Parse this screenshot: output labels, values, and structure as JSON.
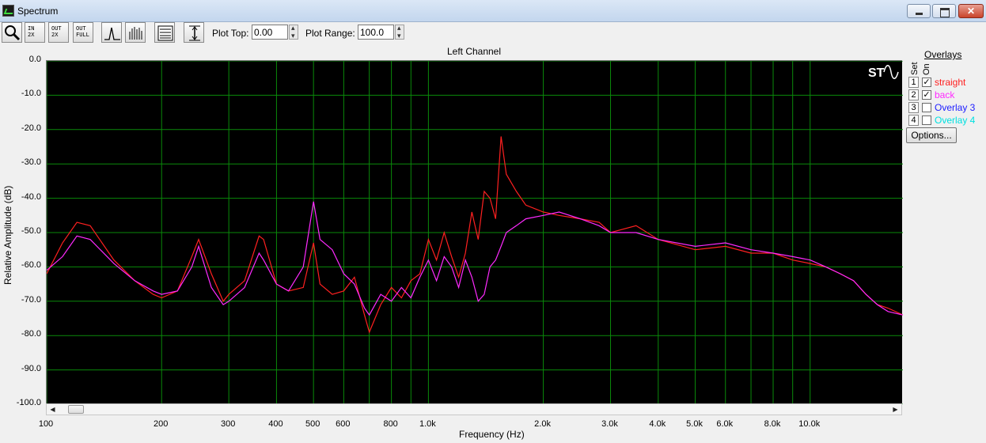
{
  "window": {
    "title": "Spectrum"
  },
  "toolbar": {
    "zoom_in_x": "IN 2X",
    "zoom_out_x": "OUT 2X",
    "zoom_out_full": "OUT FULL",
    "plot_top_label": "Plot Top:",
    "plot_top_value": "0.00",
    "plot_range_label": "Plot Range:",
    "plot_range_value": "100.0"
  },
  "plot": {
    "channel_title": "Left Channel"
  },
  "overlays": {
    "header": "Overlays",
    "col_set": "Set",
    "col_on": "On",
    "items": [
      {
        "num": "1",
        "checked": true,
        "name": "straight",
        "color": "#ff2020"
      },
      {
        "num": "2",
        "checked": true,
        "name": "back",
        "color": "#ff2aff"
      },
      {
        "num": "3",
        "checked": false,
        "name": "Overlay 3",
        "color": "#2020ff"
      },
      {
        "num": "4",
        "checked": false,
        "name": "Overlay 4",
        "color": "#00e0e0"
      }
    ],
    "options_label": "Options..."
  },
  "chart_data": {
    "type": "line",
    "title": "Left Channel",
    "xlabel": "Frequency (Hz)",
    "ylabel": "Relative Amplitude (dB)",
    "x_scale": "log",
    "xlim": [
      100,
      17500
    ],
    "ylim": [
      -100,
      0
    ],
    "x_ticks": [
      100,
      200,
      300,
      400,
      500,
      600,
      800,
      1000,
      2000,
      3000,
      4000,
      5000,
      6000,
      8000,
      10000
    ],
    "x_tick_labels": [
      "100",
      "200",
      "300",
      "400",
      "500",
      "600",
      "800",
      "1.0k",
      "2.0k",
      "3.0k",
      "4.0k",
      "5.0k",
      "6.0k",
      "8.0k",
      "10.0k"
    ],
    "y_ticks": [
      0,
      -10,
      -20,
      -30,
      -40,
      -50,
      -60,
      -70,
      -80,
      -90,
      -100
    ],
    "y_tick_labels": [
      "0.0",
      "-10.0",
      "-20.0",
      "-30.0",
      "-40.0",
      "-50.0",
      "-60.0",
      "-70.0",
      "-80.0",
      "-90.0",
      "-100.0"
    ],
    "grid": true,
    "series": [
      {
        "name": "straight",
        "color": "#ff2020",
        "x": [
          100,
          110,
          120,
          130,
          150,
          170,
          190,
          200,
          220,
          240,
          250,
          270,
          290,
          300,
          330,
          360,
          370,
          400,
          430,
          470,
          500,
          520,
          560,
          600,
          640,
          680,
          700,
          750,
          800,
          850,
          900,
          950,
          1000,
          1050,
          1100,
          1150,
          1200,
          1250,
          1300,
          1350,
          1400,
          1450,
          1500,
          1550,
          1600,
          1700,
          1800,
          2000,
          2200,
          2500,
          2800,
          3000,
          3500,
          4000,
          5000,
          6000,
          7000,
          8000,
          9000,
          10000,
          11000,
          12000,
          13000,
          14000,
          15000,
          16000,
          17500
        ],
        "y": [
          -62,
          -53,
          -47,
          -48,
          -58,
          -64,
          -68,
          -69,
          -67,
          -57,
          -52,
          -62,
          -70,
          -68,
          -64,
          -51,
          -52,
          -65,
          -67,
          -66,
          -53,
          -65,
          -68,
          -67,
          -63,
          -74,
          -79,
          -71,
          -66,
          -69,
          -64,
          -62,
          -52,
          -58,
          -50,
          -57,
          -63,
          -56,
          -44,
          -52,
          -38,
          -40,
          -46,
          -22,
          -33,
          -38,
          -42,
          -44,
          -45,
          -46,
          -47,
          -50,
          -48,
          -52,
          -55,
          -54,
          -56,
          -56,
          -58,
          -59,
          -60,
          -62,
          -64,
          -68,
          -71,
          -72,
          -74
        ]
      },
      {
        "name": "back",
        "color": "#ff2aff",
        "x": [
          100,
          110,
          120,
          130,
          150,
          170,
          190,
          200,
          220,
          240,
          250,
          270,
          290,
          300,
          330,
          360,
          370,
          400,
          430,
          470,
          500,
          520,
          560,
          600,
          640,
          680,
          700,
          750,
          800,
          850,
          900,
          950,
          1000,
          1050,
          1100,
          1150,
          1200,
          1250,
          1300,
          1350,
          1400,
          1450,
          1500,
          1550,
          1600,
          1700,
          1800,
          2000,
          2200,
          2500,
          2800,
          3000,
          3500,
          4000,
          5000,
          6000,
          7000,
          8000,
          9000,
          10000,
          11000,
          12000,
          13000,
          14000,
          15000,
          16000,
          17500
        ],
        "y": [
          -61,
          -57,
          -51,
          -52,
          -59,
          -64,
          -67,
          -68,
          -67,
          -60,
          -54,
          -66,
          -71,
          -70,
          -66,
          -56,
          -58,
          -65,
          -67,
          -60,
          -41,
          -52,
          -55,
          -62,
          -65,
          -72,
          -74,
          -68,
          -70,
          -66,
          -69,
          -63,
          -58,
          -64,
          -57,
          -60,
          -66,
          -58,
          -63,
          -70,
          -68,
          -60,
          -58,
          -54,
          -50,
          -48,
          -46,
          -45,
          -44,
          -46,
          -48,
          -50,
          -50,
          -52,
          -54,
          -53,
          -55,
          -56,
          -57,
          -58,
          -60,
          -62,
          -64,
          -68,
          -71,
          -73,
          -74
        ]
      }
    ]
  }
}
